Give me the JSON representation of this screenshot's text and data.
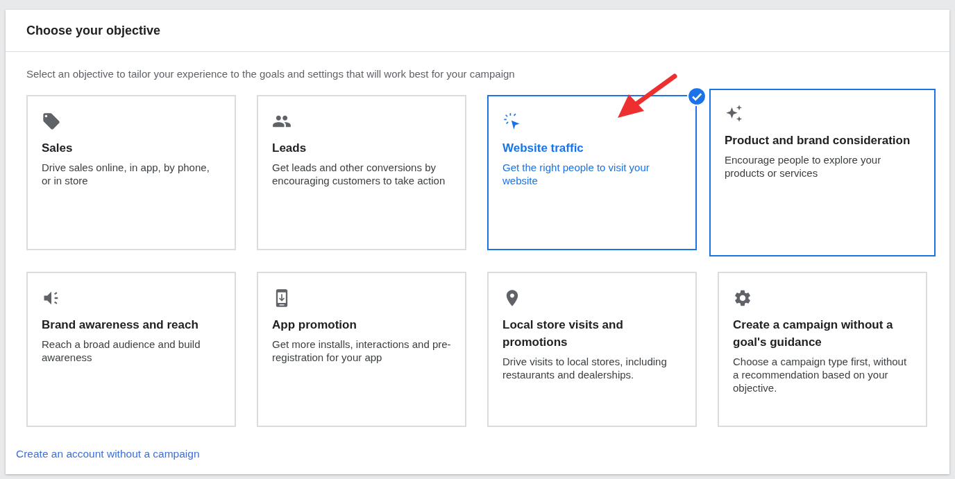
{
  "dialog": {
    "title": "Choose your objective",
    "subtitle": "Select an objective to tailor your experience to the goals and settings that will work best for your campaign"
  },
  "objectives": [
    {
      "title": "Sales",
      "description": "Drive sales online, in app, by phone, or in store",
      "selected": false,
      "focused": false
    },
    {
      "title": "Leads",
      "description": "Get leads and other conversions by encouraging customers to take action",
      "selected": false,
      "focused": false
    },
    {
      "title": "Website traffic",
      "description": "Get the right people to visit your website",
      "selected": true,
      "focused": false
    },
    {
      "title": "Product and brand consideration",
      "description": "Encourage people to explore your products or services",
      "selected": false,
      "focused": true
    },
    {
      "title": "Brand awareness and reach",
      "description": "Reach a broad audience and build awareness",
      "selected": false,
      "focused": false
    },
    {
      "title": "App promotion",
      "description": "Get more installs, interactions and pre-registration for your app",
      "selected": false,
      "focused": false
    },
    {
      "title": "Local store visits and promotions",
      "description": "Drive visits to local stores, including restaurants and dealerships.",
      "selected": false,
      "focused": false
    },
    {
      "title": "Create a campaign without a goal's guidance",
      "description": "Choose a campaign type first, without a recommendation based on your objective.",
      "selected": false,
      "focused": false
    }
  ],
  "footer_link": "Create an account without a campaign"
}
